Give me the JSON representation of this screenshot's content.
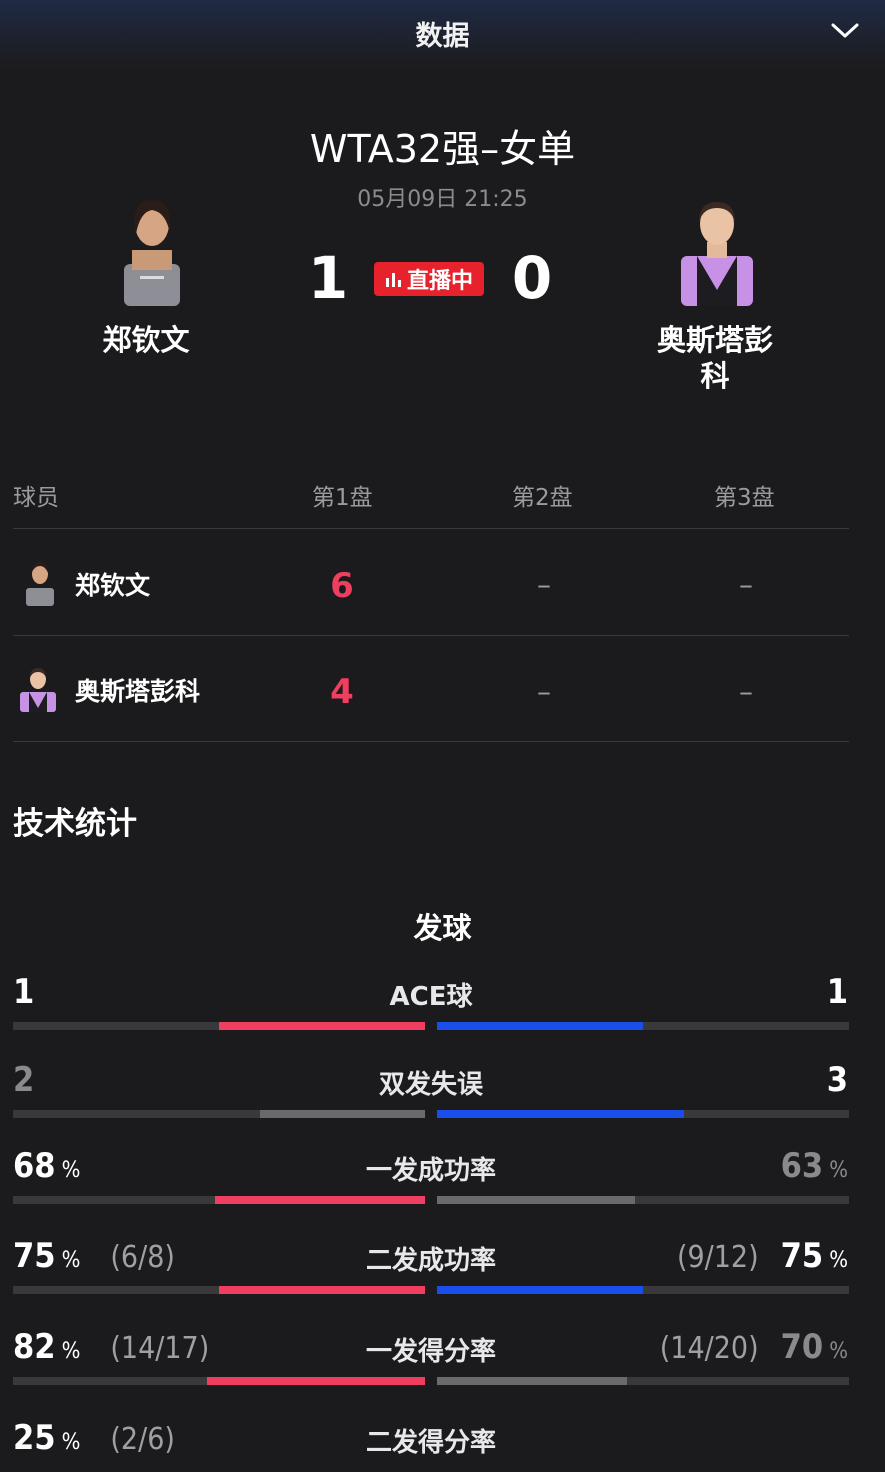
{
  "header": {
    "title": "数据"
  },
  "match": {
    "title": "WTA32强–女单",
    "time": "05月09日 21:25",
    "live_label": "直播中",
    "home": {
      "name": "郑钦文",
      "sets_won": "1"
    },
    "away": {
      "name_line1": "奥斯塔彭",
      "name_line2": "科",
      "sets_won": "0"
    }
  },
  "score_table": {
    "headers": [
      "球员",
      "第1盘",
      "第2盘",
      "第3盘"
    ],
    "rows": [
      {
        "name": "郑钦文",
        "set1": "6",
        "set2": "–",
        "set3": "–"
      },
      {
        "name": "奥斯塔彭科",
        "set1": "4",
        "set2": "–",
        "set3": "–"
      }
    ]
  },
  "stats": {
    "section_title": "技术统计",
    "group_title": "发球",
    "colors": {
      "home": "#ef3e60",
      "away": "#1a4ee8",
      "neutral": "#6a6a6d"
    },
    "items": [
      {
        "label": "ACE球",
        "left": "1",
        "right": "1",
        "left_frac": "",
        "right_frac": "",
        "left_pct": "",
        "right_pct": "",
        "left_share": 0.5,
        "right_share": 0.5,
        "left_lead": true,
        "right_lead": true
      },
      {
        "label": "双发失误",
        "left": "2",
        "right": "3",
        "left_frac": "",
        "right_frac": "",
        "left_pct": "",
        "right_pct": "",
        "left_share": 0.4,
        "right_share": 0.6,
        "left_lead": false,
        "right_lead": true
      },
      {
        "label": "一发成功率",
        "left": "68",
        "right": "63",
        "left_frac": "",
        "right_frac": "",
        "left_pct": "%",
        "right_pct": "%",
        "left_share": 0.51,
        "right_share": 0.48,
        "left_lead": true,
        "right_lead": false
      },
      {
        "label": "二发成功率",
        "left": "75",
        "right": "75",
        "left_frac": "(6/8)",
        "right_frac": "(9/12)",
        "left_pct": "%",
        "right_pct": "%",
        "left_share": 0.5,
        "right_share": 0.5,
        "left_lead": true,
        "right_lead": true
      },
      {
        "label": "一发得分率",
        "left": "82",
        "right": "70",
        "left_frac": "(14/17)",
        "right_frac": "(14/20)",
        "left_pct": "%",
        "right_pct": "%",
        "left_share": 0.53,
        "right_share": 0.46,
        "left_lead": true,
        "right_lead": false
      },
      {
        "label": "二发得分率",
        "left": "25",
        "right": "",
        "left_frac": "(2/6)",
        "right_frac": "",
        "left_pct": "%",
        "right_pct": "",
        "left_share": 0,
        "right_share": 0,
        "left_lead": true,
        "right_lead": false
      }
    ]
  }
}
